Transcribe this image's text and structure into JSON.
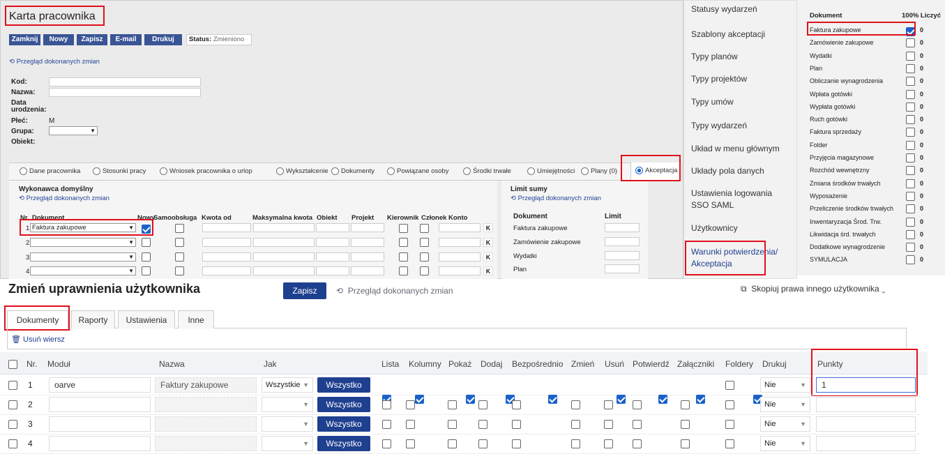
{
  "panel1": {
    "title": "Karta pracownika",
    "buttons": [
      "Zamknij",
      "Nowy",
      "Zapisz",
      "E-mail",
      "Drukuj"
    ],
    "status_label": "Status:",
    "status_value": "Zmieniono",
    "history_link": "Przegląd dokonanych zmian",
    "fields": {
      "kod": "Kod:",
      "nazwa": "Nazwa:",
      "data1": "Data",
      "data2": "urodzenia:",
      "plec": "Płeć:",
      "plec_value": "M",
      "grupa": "Grupa:",
      "obiekt": "Obiekt:"
    },
    "tabs": [
      "Dane pracownika",
      "Stosunki pracy",
      "Wniosek pracownika o urlop",
      "Wykształcenie",
      "Dokumenty",
      "Powiązane osoby",
      "Środki trwałe",
      "Umiejętności",
      "Plany (0)",
      "Akceptacja"
    ],
    "section": "Wykonawca domyślny",
    "section_link": "Przegląd dokonanych zmian",
    "cols": [
      "Nr.",
      "Dokument",
      "Nowy",
      "Samoobsługa",
      "Kwota od",
      "Maksymalna kwota",
      "Obiekt",
      "Projekt",
      "Kierownik",
      "Członek",
      "Konto"
    ],
    "rows": [
      {
        "nr": "1",
        "doc": "Faktura zakupowe"
      },
      {
        "nr": "2",
        "doc": ""
      },
      {
        "nr": "3",
        "doc": ""
      },
      {
        "nr": "4",
        "doc": ""
      }
    ],
    "k": "K",
    "limit_title": "Limit sumy",
    "limit_link": "Przegląd dokonanych zmian",
    "limit_cols": [
      "Dokument",
      "Limit"
    ],
    "limit_rows": [
      "Faktura zakupowe",
      "Zamówienie zakupowe",
      "Wydatki",
      "Plan"
    ]
  },
  "menu": {
    "items": [
      "Statusy wydarzeń",
      "Szablony akceptacji",
      "Typy planów",
      "Typy projektów",
      "Typy umów",
      "Typy wydarzeń",
      "Układ w menu głównym",
      "Układy pola danych",
      "Ustawienia logowania SSO SAML",
      "Użytkownicy",
      "Warunki potwierdzenia/ Akceptacja"
    ]
  },
  "doclist": {
    "header": "Dokument",
    "header2": "100% Liczyć",
    "items": [
      "Faktura zakupowe",
      "Zamówienie zakupowe",
      "Wydatki",
      "Plan",
      "Obliczanie wynagrodzenia",
      "Wpłata gotówki",
      "Wypłata gotówki",
      "Ruch gotówki",
      "Faktura sprzedaży",
      "Folder",
      "Przyjęcia magazynowe",
      "Rozchód wewnętrzny",
      "Zmiana środków trwałych",
      "Wyposażenie",
      "Przeliczenie środków trwałych",
      "Inwentaryzacja Środ. Trw.",
      "Likwidacja śrd. trwałych",
      "Dodatkowe wynagrodzenie",
      "SYMULACJA"
    ],
    "zero": "0"
  },
  "rights": {
    "title": "Zmień uprawnienia użytkownika",
    "save": "Zapisz",
    "history": "Przegląd dokonanych zmian",
    "copy": "Skopiuj prawa innego użytkownika",
    "tabs": [
      "Dokumenty",
      "Raporty",
      "Ustawienia",
      "Inne"
    ],
    "delete": "Usuń wiersz",
    "cols": [
      "Nr.",
      "Moduł",
      "Nazwa",
      "Jak",
      "Lista",
      "Kolumny",
      "Pokaż",
      "Dodaj",
      "Bezpośrednio",
      "Zmień",
      "Usuń",
      "Potwierdź",
      "Załączniki",
      "Foldery",
      "Drukuj",
      "Punkty"
    ],
    "rows": [
      {
        "nr": "1",
        "modul": "oarve",
        "nazwa": "Faktury zakupowe",
        "jak": "Wszystkie",
        "btn": "Wszystko",
        "drukuj": "Nie",
        "punkty": "1"
      },
      {
        "nr": "2",
        "modul": "",
        "nazwa": "",
        "jak": "",
        "btn": "Wszystko",
        "drukuj": "Nie",
        "punkty": ""
      },
      {
        "nr": "3",
        "modul": "",
        "nazwa": "",
        "jak": "",
        "btn": "Wszystko",
        "drukuj": "Nie",
        "punkty": ""
      },
      {
        "nr": "4",
        "modul": "",
        "nazwa": "",
        "jak": "",
        "btn": "Wszystko",
        "drukuj": "Nie",
        "punkty": ""
      }
    ]
  },
  "colors": {
    "accent": "#1f3f8f",
    "highlight": "#e0101c",
    "checkbox": "#1a62c9"
  }
}
